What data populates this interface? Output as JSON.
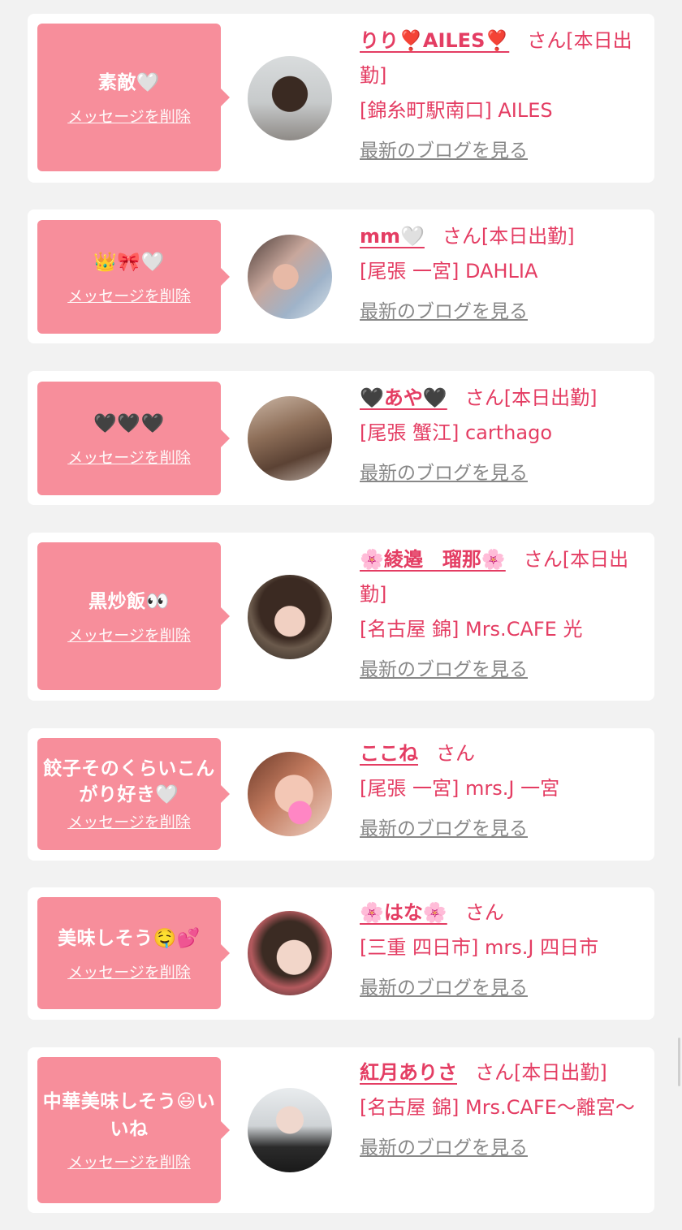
{
  "delete_label": "メッセージを削除",
  "blog_label": "最新のブログを見る",
  "san": "さん",
  "cards": [
    {
      "msg": "素敵🤍",
      "name": "りり❣️AILES❣️",
      "status": "[本日出勤]",
      "shop": "[錦糸町駅南口] AILES"
    },
    {
      "msg": "👑🎀🤍",
      "name": "mm🤍",
      "status": "[本日出勤]",
      "shop": "[尾張 一宮] DAHLIA"
    },
    {
      "msg": "🖤🖤🖤",
      "name": "🖤あや🖤",
      "status": "[本日出勤]",
      "shop": "[尾張 蟹江] carthago"
    },
    {
      "msg": "黒炒飯👀",
      "name": "🌸綾邉　瑠那🌸",
      "status": "[本日出勤]",
      "shop": "[名古屋 錦] Mrs.CAFE 光"
    },
    {
      "msg": "餃子そのくらいこんがり好き🤍",
      "name": "ここね",
      "status": "",
      "shop": "[尾張 一宮] mrs.J 一宮"
    },
    {
      "msg": "美味しそう🤤💕",
      "name": "🌸はな🌸",
      "status": "",
      "shop": "[三重 四日市] mrs.J 四日市"
    },
    {
      "msg": "中華美味しそう😃いいね",
      "name": "紅月ありさ",
      "status": "[本日出勤]",
      "shop": "[名古屋 錦] Mrs.CAFE〜離宮〜"
    }
  ]
}
